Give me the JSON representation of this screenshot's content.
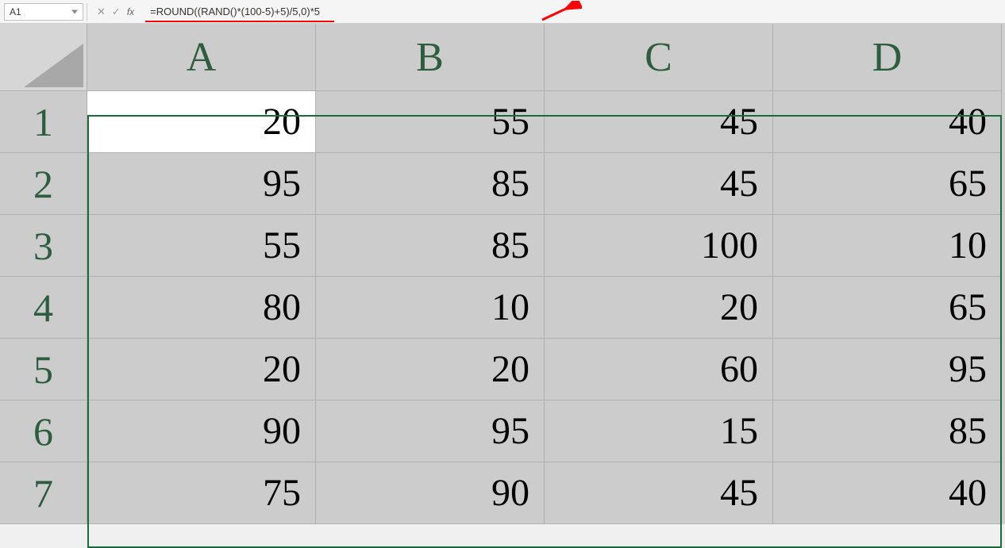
{
  "formula_bar": {
    "cell_reference": "A1",
    "formula": "=ROUND((RAND()*(100-5)+5)/5,0)*5",
    "fx_label": "fx"
  },
  "columns": [
    "A",
    "B",
    "C",
    "D"
  ],
  "rows": [
    "1",
    "2",
    "3",
    "4",
    "5",
    "6",
    "7"
  ],
  "cells": [
    [
      "20",
      "55",
      "45",
      "40"
    ],
    [
      "95",
      "85",
      "45",
      "65"
    ],
    [
      "55",
      "85",
      "100",
      "10"
    ],
    [
      "80",
      "10",
      "20",
      "65"
    ],
    [
      "20",
      "20",
      "60",
      "95"
    ],
    [
      "90",
      "95",
      "15",
      "85"
    ],
    [
      "75",
      "90",
      "45",
      "40"
    ]
  ],
  "active_cell": {
    "row": 0,
    "col": 0
  }
}
